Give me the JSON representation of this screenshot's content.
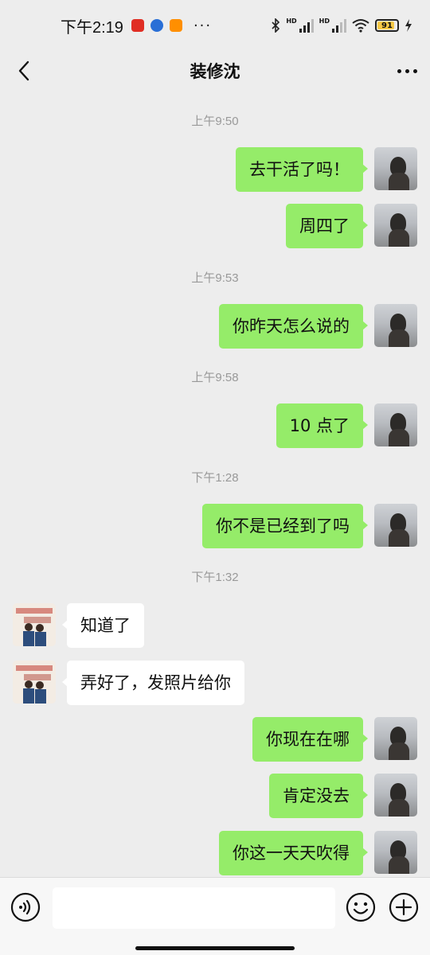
{
  "status_bar": {
    "time": "下午2:19",
    "dots": "···",
    "battery": "91",
    "app_icons": [
      "pinduoduo-icon",
      "app-icon",
      "taobao-icon"
    ],
    "colors": {
      "pinduoduo": "#e02e24",
      "app": "#2a6fd6",
      "taobao": "#ff8f00"
    }
  },
  "header": {
    "title": "装修沈"
  },
  "messages": [
    {
      "type": "timestamp",
      "text": "上午9:50"
    },
    {
      "type": "me",
      "text": "去干活了吗！"
    },
    {
      "type": "me",
      "text": "周四了"
    },
    {
      "type": "timestamp",
      "text": "上午9:53"
    },
    {
      "type": "me",
      "text": "你昨天怎么说的"
    },
    {
      "type": "timestamp",
      "text": "上午9:58"
    },
    {
      "type": "me",
      "text": "10 点了"
    },
    {
      "type": "timestamp",
      "text": "下午1:28"
    },
    {
      "type": "me",
      "text": "你不是已经到了吗"
    },
    {
      "type": "timestamp",
      "text": "下午1:32"
    },
    {
      "type": "them",
      "text": "知道了"
    },
    {
      "type": "them",
      "text": "弄好了，发照片给你"
    },
    {
      "type": "me",
      "text": "你现在在哪"
    },
    {
      "type": "me",
      "text": "肯定没去"
    },
    {
      "type": "me",
      "text": "你这一天天吹得"
    }
  ],
  "colors": {
    "background": "#ededed",
    "my_bubble": "#95ec69",
    "their_bubble": "#ffffff",
    "timestamp": "#999999"
  },
  "input_bar": {
    "icons": [
      "voice-icon",
      "emoji-icon",
      "plus-icon"
    ],
    "text_value": ""
  }
}
